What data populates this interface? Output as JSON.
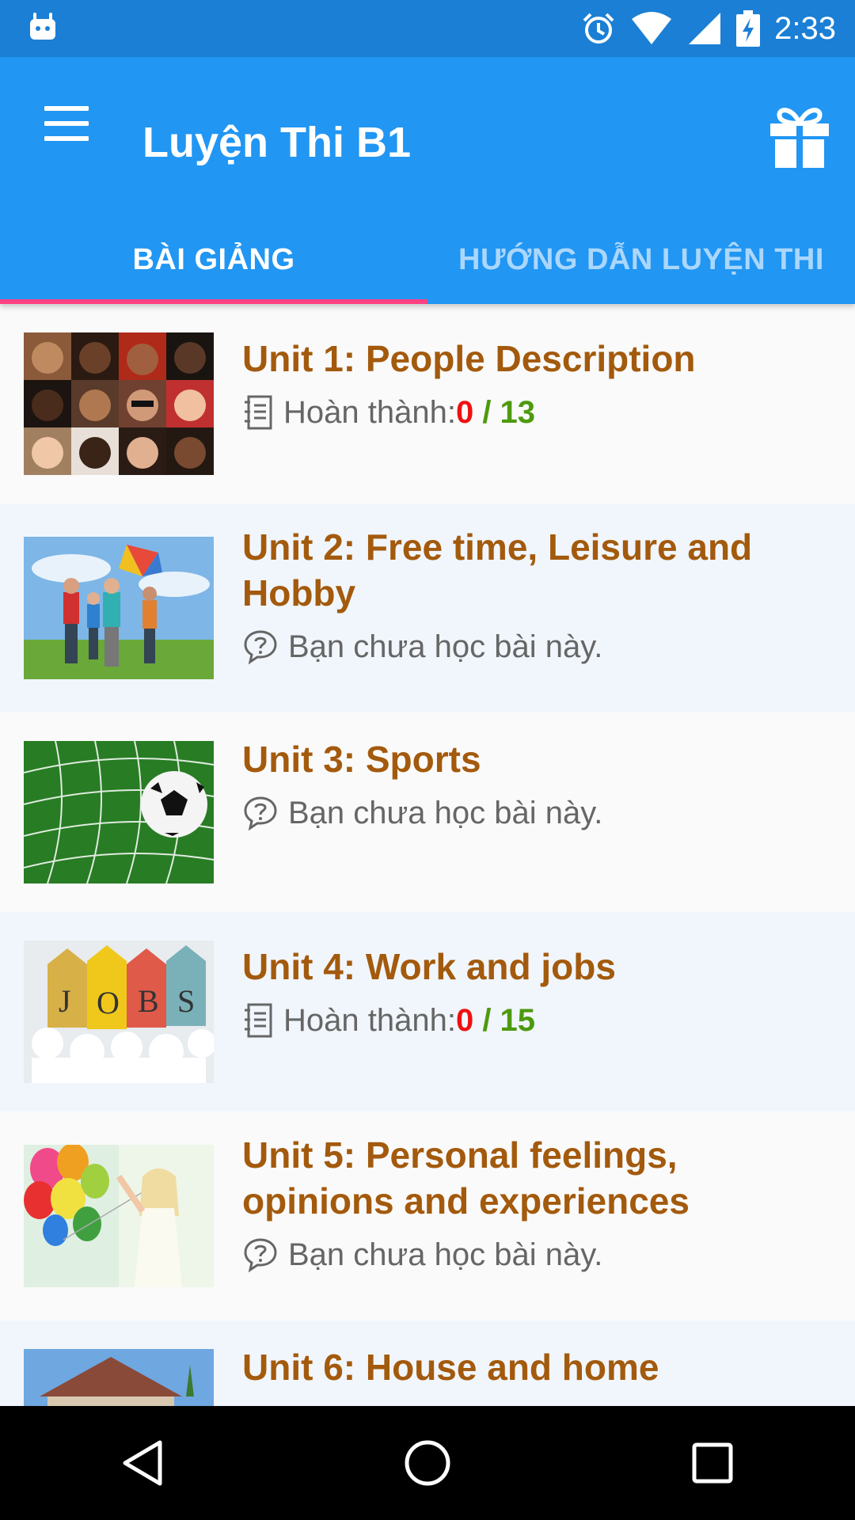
{
  "status_bar": {
    "time": "2:33",
    "icons": [
      "android-icon",
      "alarm-icon",
      "wifi-icon",
      "signal-icon",
      "battery-charging-icon"
    ]
  },
  "app_bar": {
    "title": "Luyện Thi B1",
    "menu_icon": "hamburger-menu-icon",
    "gift_icon": "gift-icon",
    "primary_color": "#2196f3",
    "status_color": "#1c7fd6"
  },
  "tabs": [
    {
      "label": "BÀI GIẢNG",
      "active": true
    },
    {
      "label": "HƯỚNG DẪN LUYỆN THI",
      "active": false
    }
  ],
  "tab_indicator_color": "#ff4081",
  "units": [
    {
      "title": "Unit 1: People Description",
      "status_type": "progress",
      "progress_label": "Hoàn thành: ",
      "done": "0",
      "separator": " / ",
      "total": "13",
      "icon": "notebook-icon",
      "thumbnail": "faces-collage-image"
    },
    {
      "title": "Unit 2: Free time, Leisure and Hobby",
      "status_type": "not-started",
      "status_text": "Bạn chưa học bài này.",
      "icon": "question-bubble-icon",
      "thumbnail": "kids-running-kite-image"
    },
    {
      "title": "Unit 3: Sports",
      "status_type": "not-started",
      "status_text": "Bạn chưa học bài này.",
      "icon": "question-bubble-icon",
      "thumbnail": "soccer-ball-net-image"
    },
    {
      "title": "Unit 4: Work and jobs",
      "status_type": "progress",
      "progress_label": "Hoàn thành: ",
      "done": "0",
      "separator": " / ",
      "total": "15",
      "icon": "notebook-icon",
      "thumbnail": "jobs-tags-image"
    },
    {
      "title": "Unit 5: Personal feelings, opinions and experiences",
      "status_type": "not-started",
      "status_text": "Bạn chưa học bài này.",
      "icon": "question-bubble-icon",
      "thumbnail": "woman-balloons-image"
    },
    {
      "title": "Unit 6: House and home",
      "status_type": "not-started",
      "status_text": "",
      "icon": "",
      "thumbnail": "house-image"
    }
  ],
  "nav_bar": {
    "buttons": [
      "back-icon",
      "home-icon",
      "recents-icon"
    ]
  }
}
